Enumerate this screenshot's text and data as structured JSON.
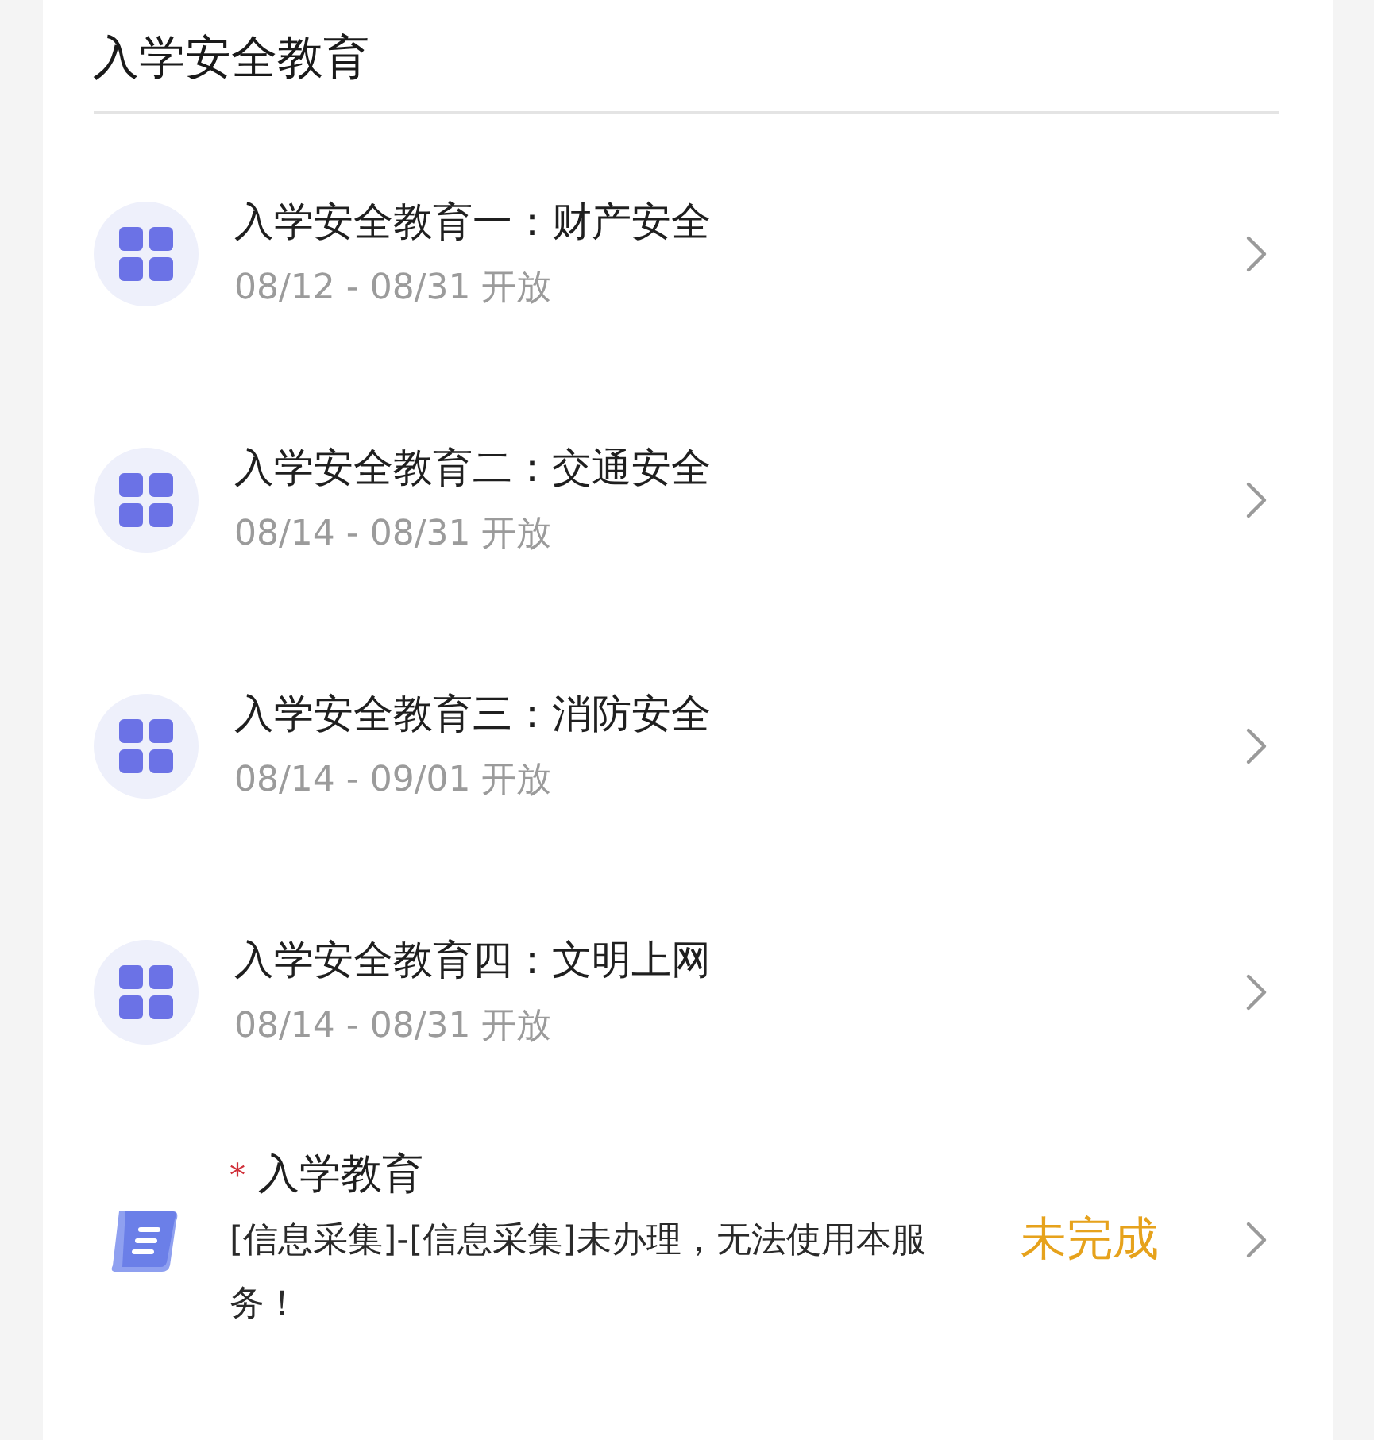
{
  "title": "入学安全教育",
  "items": [
    {
      "title": "入学安全教育一：财产安全",
      "date": "08/12 - 08/31 开放"
    },
    {
      "title": "入学安全教育二：交通安全",
      "date": "08/14 - 08/31 开放"
    },
    {
      "title": "入学安全教育三：消防安全",
      "date": "08/14 - 09/01 开放"
    },
    {
      "title": "入学安全教育四：文明上网",
      "date": "08/14 - 08/31 开放"
    }
  ],
  "task": {
    "required_mark": "*",
    "title": "入学教育",
    "message": "[信息采集]-[信息采集]未办理，无法使用本服务！",
    "status": "未完成"
  }
}
